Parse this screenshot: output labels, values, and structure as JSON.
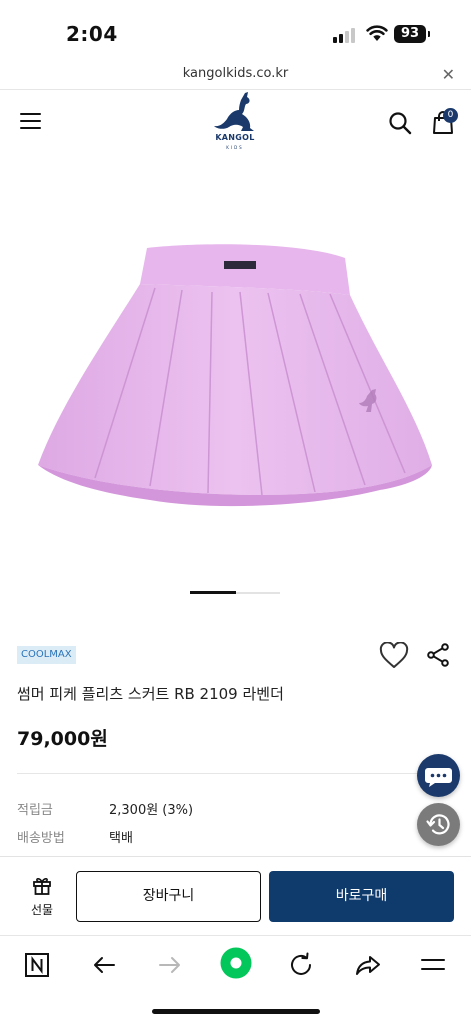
{
  "status_bar": {
    "time": "2:04",
    "battery": "93"
  },
  "browser": {
    "url": "kangolkids.co.kr"
  },
  "header": {
    "logo_text": "KANGOL",
    "logo_subtext": "KIDS",
    "cart_count": "0"
  },
  "product": {
    "image_watermark": "kangol",
    "gallery": {
      "current": 1,
      "total": 2
    },
    "badge": "COOLMAX",
    "title": "썸머 피케 플리츠 스커트 RB 2109 라벤더",
    "price": "79,000원",
    "info": [
      {
        "label": "적립금",
        "value": "2,300원 (3%)"
      },
      {
        "label": "배송방법",
        "value": "택배"
      }
    ]
  },
  "buy_bar": {
    "gift_label": "선물",
    "cart_button": "장바구니",
    "buy_button": "바로구매"
  },
  "colors": {
    "brand_navy": "#0f3a6c",
    "skirt_lavender": "#e6b6eb",
    "badge_bg": "#dcecf7",
    "badge_text": "#2a73b9",
    "naver_green": "#03c75a"
  }
}
